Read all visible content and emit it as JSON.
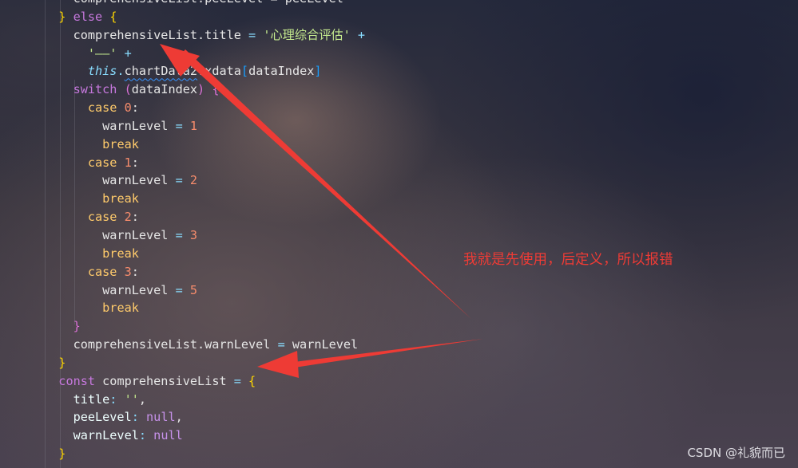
{
  "editor": {
    "lines": [
      [
        {
          "t": "    comprehensiveList.peeLevel = peeLevel",
          "c": "tok-id"
        }
      ],
      [
        {
          "t": "  ",
          "c": ""
        },
        {
          "t": "}",
          "c": "tok-brace-y"
        },
        {
          "t": " else ",
          "c": "kw"
        },
        {
          "t": "{",
          "c": "tok-brace-y"
        }
      ],
      [
        {
          "t": "    comprehensiveList.title ",
          "c": "tok-id"
        },
        {
          "t": "= ",
          "c": "tok-op"
        },
        {
          "t": "'心理综合评估'",
          "c": "tok-str"
        },
        {
          "t": " +",
          "c": "tok-op"
        }
      ],
      [
        {
          "t": "      ",
          "c": ""
        },
        {
          "t": "'——'",
          "c": "tok-str"
        },
        {
          "t": " +",
          "c": "tok-op"
        }
      ],
      [
        {
          "t": "      ",
          "c": ""
        },
        {
          "t": "this",
          "c": "tok-this"
        },
        {
          "t": ".",
          "c": "tok-op"
        },
        {
          "t": "chartData2",
          "c": "tok-id squiggle"
        },
        {
          "t": ".xdata",
          "c": "tok-id"
        },
        {
          "t": "[",
          "c": "tok-brace-b"
        },
        {
          "t": "dataIndex",
          "c": "tok-id"
        },
        {
          "t": "]",
          "c": "tok-brace-b"
        }
      ],
      [
        {
          "t": "    ",
          "c": ""
        },
        {
          "t": "switch",
          "c": "kw"
        },
        {
          "t": " (",
          "c": "tok-brace-p"
        },
        {
          "t": "dataIndex",
          "c": "tok-id"
        },
        {
          "t": ") ",
          "c": "tok-brace-p"
        },
        {
          "t": "{",
          "c": "tok-brace-p"
        }
      ],
      [
        {
          "t": "      ",
          "c": ""
        },
        {
          "t": "case",
          "c": "tok-case"
        },
        {
          "t": " 0",
          "c": "tok-num"
        },
        {
          "t": ":",
          "c": "tok-id"
        }
      ],
      [
        {
          "t": "        warnLevel ",
          "c": "tok-id"
        },
        {
          "t": "= ",
          "c": "tok-op"
        },
        {
          "t": "1",
          "c": "tok-num"
        }
      ],
      [
        {
          "t": "        ",
          "c": ""
        },
        {
          "t": "break",
          "c": "tok-break"
        }
      ],
      [
        {
          "t": "      ",
          "c": ""
        },
        {
          "t": "case",
          "c": "tok-case"
        },
        {
          "t": " 1",
          "c": "tok-num"
        },
        {
          "t": ":",
          "c": "tok-id"
        }
      ],
      [
        {
          "t": "        warnLevel ",
          "c": "tok-id"
        },
        {
          "t": "= ",
          "c": "tok-op"
        },
        {
          "t": "2",
          "c": "tok-num"
        }
      ],
      [
        {
          "t": "        ",
          "c": ""
        },
        {
          "t": "break",
          "c": "tok-break"
        }
      ],
      [
        {
          "t": "      ",
          "c": ""
        },
        {
          "t": "case",
          "c": "tok-case"
        },
        {
          "t": " 2",
          "c": "tok-num"
        },
        {
          "t": ":",
          "c": "tok-id"
        }
      ],
      [
        {
          "t": "        warnLevel ",
          "c": "tok-id"
        },
        {
          "t": "= ",
          "c": "tok-op"
        },
        {
          "t": "3",
          "c": "tok-num"
        }
      ],
      [
        {
          "t": "        ",
          "c": ""
        },
        {
          "t": "break",
          "c": "tok-break"
        }
      ],
      [
        {
          "t": "      ",
          "c": ""
        },
        {
          "t": "case",
          "c": "tok-case"
        },
        {
          "t": " 3",
          "c": "tok-num"
        },
        {
          "t": ":",
          "c": "tok-id"
        }
      ],
      [
        {
          "t": "        warnLevel ",
          "c": "tok-id"
        },
        {
          "t": "= ",
          "c": "tok-op"
        },
        {
          "t": "5",
          "c": "tok-num"
        }
      ],
      [
        {
          "t": "        ",
          "c": ""
        },
        {
          "t": "break",
          "c": "tok-break"
        }
      ],
      [
        {
          "t": "    ",
          "c": ""
        },
        {
          "t": "}",
          "c": "tok-brace-p"
        }
      ],
      [
        {
          "t": "    comprehensiveList.warnLevel ",
          "c": "tok-id"
        },
        {
          "t": "= ",
          "c": "tok-op"
        },
        {
          "t": "warnLevel",
          "c": "tok-id"
        }
      ],
      [
        {
          "t": "  ",
          "c": ""
        },
        {
          "t": "}",
          "c": "tok-brace-y"
        }
      ],
      [
        {
          "t": "  ",
          "c": ""
        },
        {
          "t": "const",
          "c": "kw"
        },
        {
          "t": " comprehensiveList ",
          "c": "tok-id"
        },
        {
          "t": "= ",
          "c": "tok-op"
        },
        {
          "t": "{",
          "c": "tok-brace-y"
        }
      ],
      [
        {
          "t": "    title",
          "c": "tok-prop"
        },
        {
          "t": ": ",
          "c": "tok-op"
        },
        {
          "t": "''",
          "c": "tok-str"
        },
        {
          "t": ",",
          "c": "tok-id"
        }
      ],
      [
        {
          "t": "    peeLevel",
          "c": "tok-prop"
        },
        {
          "t": ": ",
          "c": "tok-op"
        },
        {
          "t": "null",
          "c": "tok-null"
        },
        {
          "t": ",",
          "c": "tok-id"
        }
      ],
      [
        {
          "t": "    warnLevel",
          "c": "tok-prop"
        },
        {
          "t": ": ",
          "c": "tok-op"
        },
        {
          "t": "null",
          "c": "tok-null"
        }
      ],
      [
        {
          "t": "  ",
          "c": ""
        },
        {
          "t": "}",
          "c": "tok-brace-y"
        }
      ]
    ]
  },
  "annotation": {
    "text": "我就是先使用，后定义，所以报错",
    "color": "#ee3b35"
  },
  "watermark": {
    "text": "CSDN @礼貌而已"
  },
  "colors": {
    "keyword": "#c678dd",
    "string": "#c3e88d",
    "number": "#f78c6c",
    "arrow": "#ee3b35"
  }
}
